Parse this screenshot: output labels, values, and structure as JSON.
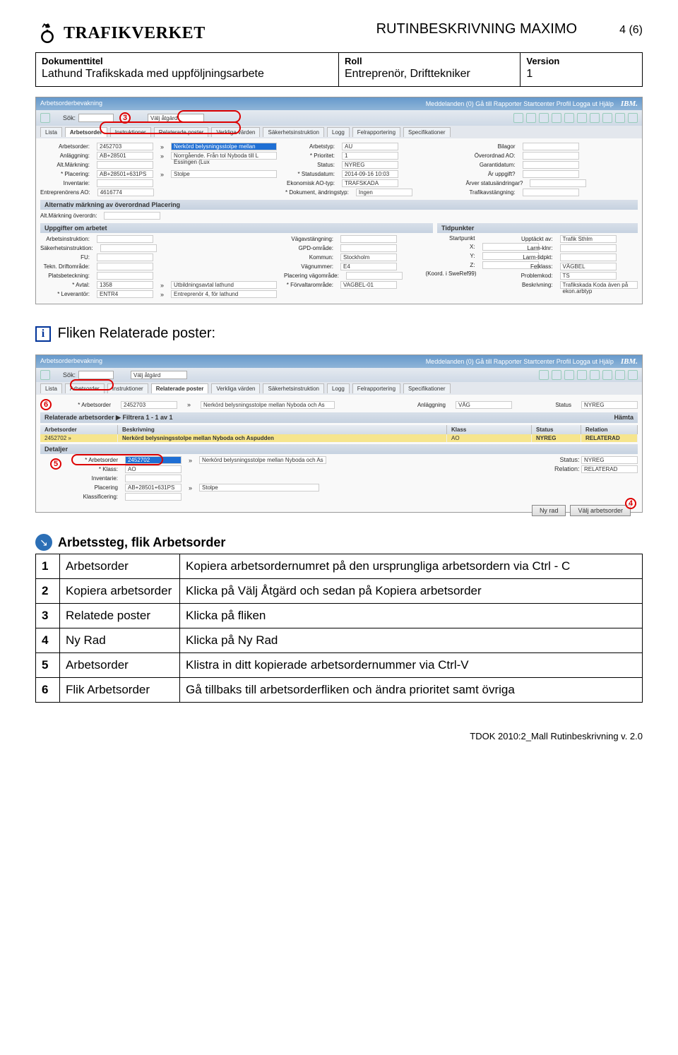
{
  "header": {
    "brand": "TRAFIKVERKET",
    "title": "RUTINBESKRIVNING MAXIMO",
    "page_num": "4 (6)"
  },
  "meta": {
    "col1_label": "Dokumenttitel",
    "col1_val": "Lathund Trafikskada med uppföljningsarbete",
    "col2_label": "Roll",
    "col2_val": "Entreprenör, Drifttekniker",
    "col3_label": "Version",
    "col3_val": "1"
  },
  "ss1": {
    "app_title": "Arbetsorderbevakning",
    "top_links": "Meddelanden (0)   Gå till   Rapporter   Startcenter   Profil   Logga ut   Hjälp",
    "ibm": "IBM.",
    "sok_label": "Sök:",
    "atgard_placeholder": "Välj åtgärd",
    "tabs": [
      "Lista",
      "Arbetsorder",
      "Instruktioner",
      "Relaterade poster",
      "Verkliga värden",
      "Säkerhetsinstruktion",
      "Logg",
      "Felrapportering",
      "Specifikationer"
    ],
    "active_tab": 1,
    "fields_left": [
      {
        "label": "Arbetsorder:",
        "val": "2452703",
        "extra": "Nerkörd belysningsstolpe mellan Nyboda och As"
      },
      {
        "label": "Anläggning:",
        "val": "AB+28501",
        "extra": "Norrgående. Från tol Nyboda till L Essingen (Lux"
      },
      {
        "label": "Alt.Märkning:",
        "val": ""
      },
      {
        "label": "* Placering:",
        "val": "AB+28501+631PS",
        "extra": "Stolpe"
      },
      {
        "label": "Inventarie:",
        "val": ""
      },
      {
        "label": "Entreprenörens AO:",
        "val": "4616774"
      }
    ],
    "fields_mid": [
      {
        "label": "Arbetstyp:",
        "val": "AU"
      },
      {
        "label": "* Prioritet:",
        "val": "1"
      },
      {
        "label": "Status:",
        "val": "NYREG"
      },
      {
        "label": "* Statusdatum:",
        "val": "2014-09-16 10:03"
      },
      {
        "label": "Ekonomisk AO-typ:",
        "val": "TRAFSKADA"
      },
      {
        "label": "* Dokument, ändringstyp:",
        "val": "Ingen"
      }
    ],
    "fields_right": [
      {
        "label": "Bilagor",
        "val": ""
      },
      {
        "label": "Överordnad AO:",
        "val": ""
      },
      {
        "label": "Garantidatum:",
        "val": ""
      },
      {
        "label": "Är uppgift?",
        "val": ""
      },
      {
        "label": "Ärver statusändringar?",
        "val": ""
      },
      {
        "label": "Trafikavstängning:",
        "val": ""
      }
    ],
    "section2_head": "Alternativ märkning av överordnad Placering",
    "alt_mark_label": "Alt.Märkning överordn:",
    "section3a": "Uppgifter om arbetet",
    "section3b": "Tidpunkter",
    "work_left": [
      {
        "label": "Arbetsinstruktion:",
        "val": ""
      },
      {
        "label": "Säkerhetsinstruktion:",
        "val": ""
      },
      {
        "label": "FU:",
        "val": ""
      },
      {
        "label": "Tekn. Driftområde:",
        "val": ""
      },
      {
        "label": "Platsbeteckning:",
        "val": ""
      },
      {
        "label": "* Avtal:",
        "val": "1358",
        "extra": "Utbildningsavtal lathund"
      },
      {
        "label": "* Leverantör:",
        "val": "ENTR4",
        "extra": "Entreprenör 4, för lathund"
      }
    ],
    "work_mid": [
      {
        "label": "Vägavstängning:",
        "val": ""
      },
      {
        "label": "GPD-område:",
        "val": ""
      },
      {
        "label": "Kommun:",
        "val": "Stockholm"
      },
      {
        "label": "Vägnummer:",
        "val": "E4"
      },
      {
        "label": "Placering vägområde:",
        "val": ""
      },
      {
        "label": "* Förvaltarområde:",
        "val": "VAGBEL-01"
      }
    ],
    "work_coord": [
      {
        "label": "Startpunkt"
      },
      {
        "label": "X:",
        "val": ""
      },
      {
        "label": "Y:",
        "val": ""
      },
      {
        "label": "Z:",
        "val": ""
      },
      {
        "label": "(Koord. i SweRef99)"
      }
    ],
    "work_right": [
      {
        "label": "Upptäckt av:",
        "val": "Trafik Sthlm"
      },
      {
        "label": "Larm-klnr:",
        "val": ""
      },
      {
        "label": "Larm-tidpkt:",
        "val": ""
      },
      {
        "label": "Felklass:",
        "val": "VÄGBEL"
      },
      {
        "label": "Problemkod:",
        "val": "TS"
      },
      {
        "label": "Beskrivning:",
        "val": "Trafikskada Koda även på ekon.arbtyp"
      }
    ]
  },
  "mid_section_label": "Fliken Relaterade poster:",
  "ss2": {
    "app_title": "Arbetsorderbevakning",
    "top_links": "Meddelanden (0)   Gå till   Rapporter   Startcenter   Profil   Logga ut   Hjälp",
    "ibm": "IBM.",
    "sok_label": "Sök:",
    "atgard_placeholder": "Välj åtgärd",
    "tabs": [
      "Lista",
      "Arbetsorder",
      "Instruktioner",
      "Relaterade poster",
      "Verkliga värden",
      "Säkerhetsinstruktion",
      "Logg",
      "Felrapportering",
      "Specifikationer"
    ],
    "active_tab": 3,
    "top_row": {
      "ao_label": "* Arbetsorder",
      "ao_val": "2452703",
      "desc": "Nerkörd belysningsstolpe mellan Nyboda och As",
      "anl_label": "Anläggning",
      "anl_val": "VÄG",
      "status_label": "Status",
      "status_val": "NYREG"
    },
    "related_head": "Relaterade arbetsorder    ▶ Filtrera         1 - 1 av 1",
    "hamta": "Hämta",
    "columns": [
      "Arbetsorder",
      "Beskrivning",
      "Klass",
      "Status",
      "Relation"
    ],
    "row1": {
      "ao": "2452702",
      "desc": "Nerkörd belysningsstolpe mellan Nyboda och Aspudden",
      "klass": "AO",
      "status": "NYREG",
      "rel": "RELATERAD"
    },
    "detaljer": "Detaljer",
    "det_fields": [
      {
        "label": "* Arbetsorder",
        "val": "2452702",
        "extra": "Nerkörd belysningsstolpe mellan Nyboda och As",
        "status": "NYREG"
      },
      {
        "label": "* Klass:",
        "val": "AO",
        "rel": "RELATERAD"
      },
      {
        "label": "Inventarie:",
        "val": ""
      },
      {
        "label": "Placering",
        "val": "AB+28501+631PS",
        "extra": "Stolpe"
      },
      {
        "label": "Klassificering:",
        "val": ""
      }
    ],
    "valj_btn": "Välj arbetsorder",
    "nyrad_btn": "Ny rad"
  },
  "steps_heading": "Arbetssteg, flik Arbetsorder",
  "table": {
    "rows": [
      {
        "n": "1",
        "key": "Arbetsorder",
        "desc": "Kopiera arbetsordernumret på den ursprungliga arbetsordern via Ctrl - C"
      },
      {
        "n": "2",
        "key": "Kopiera arbetsorder",
        "desc": "Klicka på Välj Åtgärd och sedan på Kopiera arbetsorder"
      },
      {
        "n": "3",
        "key": "Relatede poster",
        "desc": "Klicka på fliken"
      },
      {
        "n": "4",
        "key": "Ny Rad",
        "desc": "Klicka på Ny Rad"
      },
      {
        "n": "5",
        "key": "Arbetsorder",
        "desc": "Klistra in ditt kopierade arbetsordernummer via Ctrl-V"
      },
      {
        "n": "6",
        "key": "Flik Arbetsorder",
        "desc": "Gå tillbaks till arbetsorderfliken och ändra prioritet samt övriga"
      }
    ]
  },
  "footer": "TDOK 2010:2_Mall Rutinbeskrivning v. 2.0",
  "callouts": {
    "c3": "3",
    "c6": "6",
    "c5": "5",
    "c4": "4"
  }
}
